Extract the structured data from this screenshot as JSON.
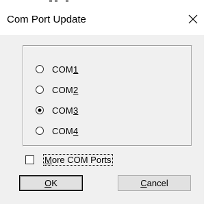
{
  "window": {
    "title": "Com Port Update",
    "close_icon": "close-icon"
  },
  "ports": {
    "selected": "COM3",
    "options": [
      {
        "prefix": "COM",
        "mnemonic": "1",
        "value": "COM1",
        "checked": false
      },
      {
        "prefix": "COM",
        "mnemonic": "2",
        "value": "COM2",
        "checked": false
      },
      {
        "prefix": "COM",
        "mnemonic": "3",
        "value": "COM3",
        "checked": true
      },
      {
        "prefix": "COM",
        "mnemonic": "4",
        "value": "COM4",
        "checked": false
      }
    ]
  },
  "more_ports": {
    "mnemonic": "M",
    "rest": "ore COM Ports",
    "checked": false
  },
  "buttons": {
    "ok_mnemonic": "O",
    "ok_rest": "K",
    "cancel_mnemonic": "C",
    "cancel_rest": "ancel"
  },
  "colors": {
    "title_bg": "#ffffff",
    "client_bg": "#f0f0f0",
    "button_bg": "#e1e1e1"
  }
}
